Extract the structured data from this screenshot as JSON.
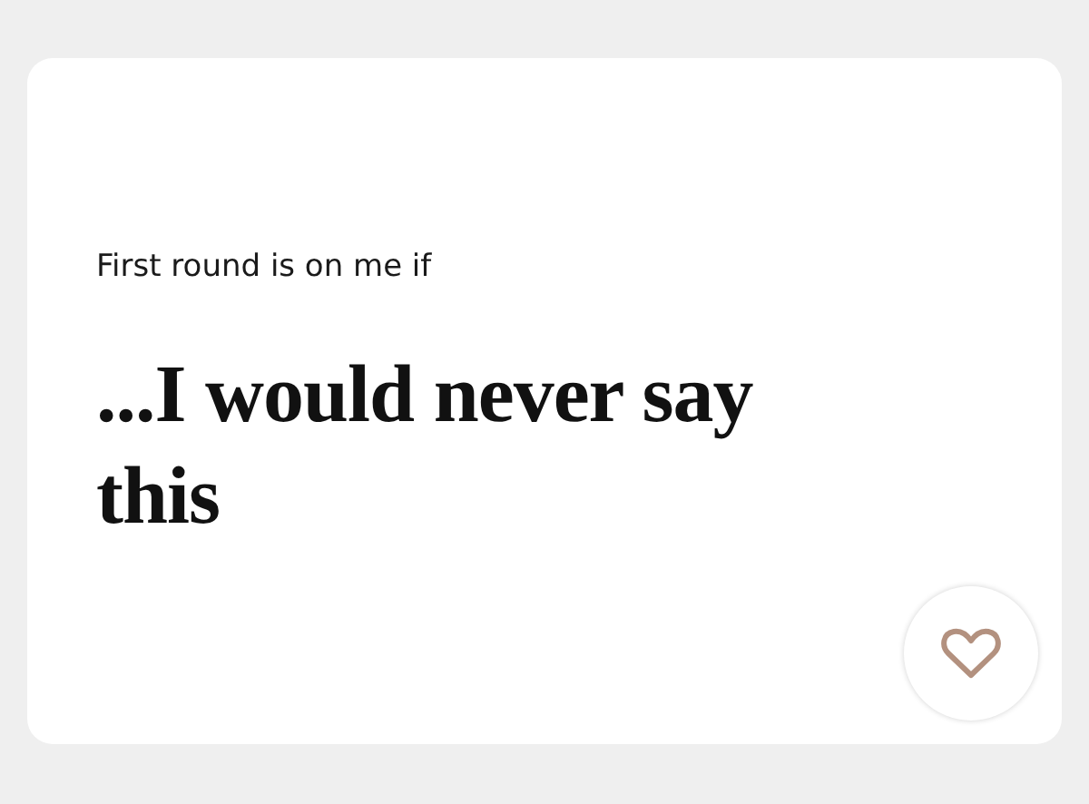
{
  "prompt": {
    "question": "First round is on me if",
    "answer": "...I would never say this"
  },
  "like_button": {
    "liked": false
  }
}
